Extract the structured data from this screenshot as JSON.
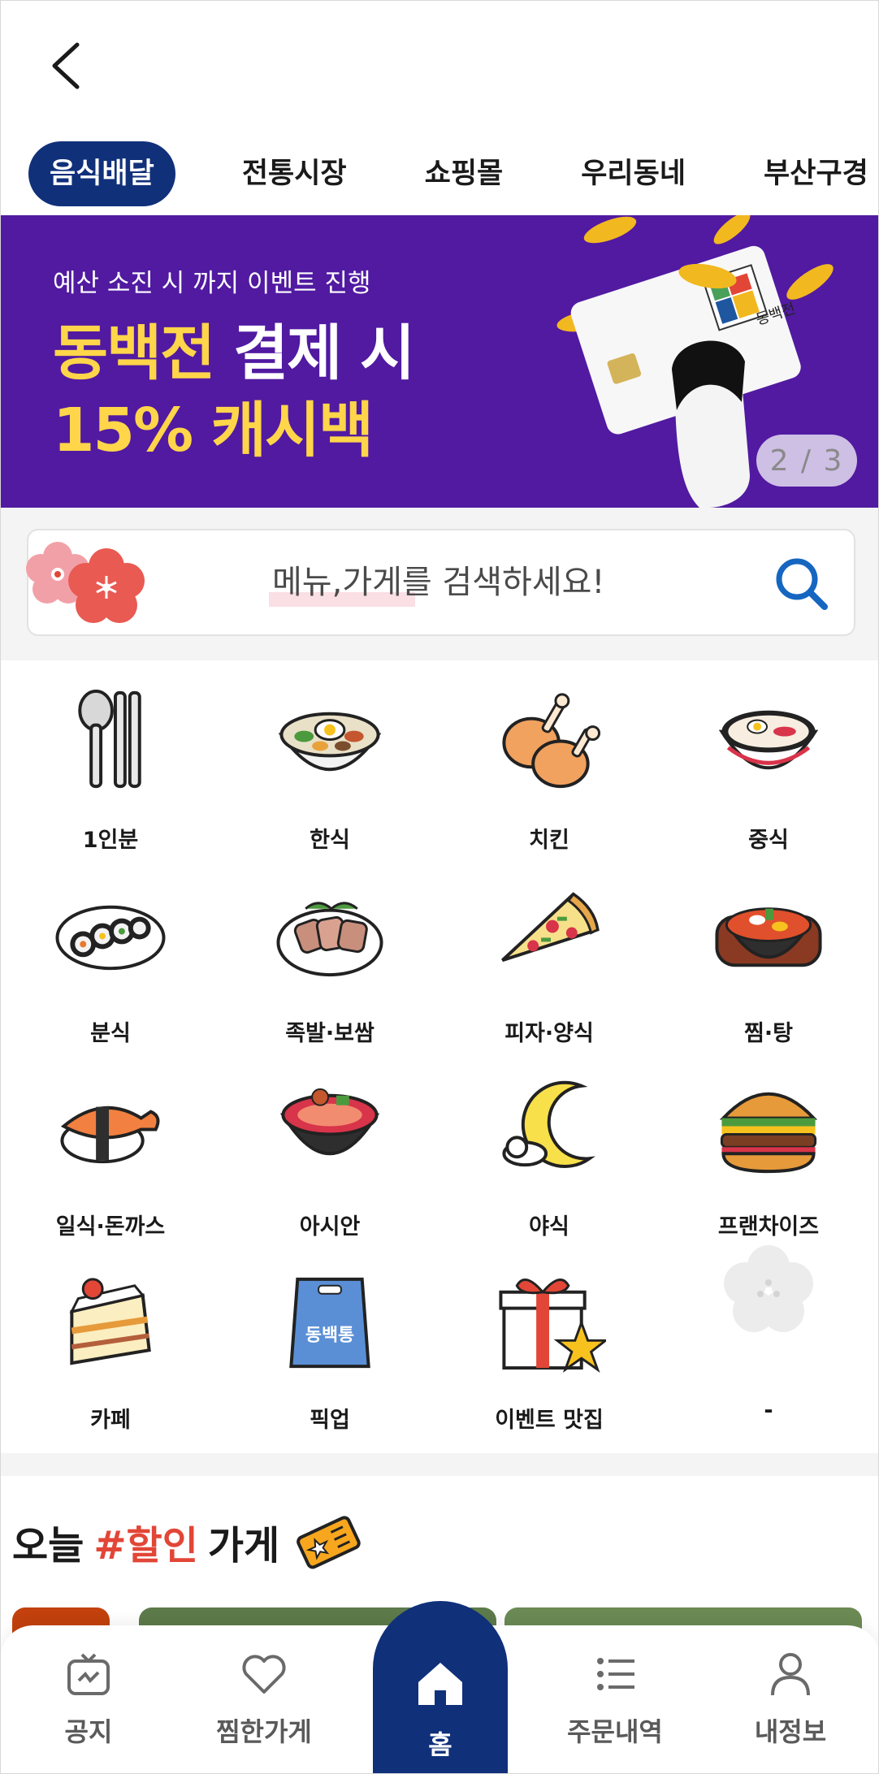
{
  "tabs": [
    {
      "label": "음식배달",
      "active": true
    },
    {
      "label": "전통시장"
    },
    {
      "label": "쇼핑몰"
    },
    {
      "label": "우리동네"
    },
    {
      "label": "부산구경"
    }
  ],
  "banner": {
    "subtitle": "예산 소진 시 까지 이벤트 진행",
    "line1_brand": "동백전",
    "line1_rest": "결제 시",
    "line2": "15% 캐시백",
    "card_text": "동백전",
    "pager": "2 / 3",
    "bg_color": "#511aa1",
    "accent_color": "#ffd54a"
  },
  "search": {
    "placeholder": "메뉴,가게를 검색하세요!"
  },
  "categories": [
    {
      "label": "1인분",
      "icon": "spoon-chopsticks-icon"
    },
    {
      "label": "한식",
      "icon": "bibimbap-icon"
    },
    {
      "label": "치킨",
      "icon": "chicken-icon"
    },
    {
      "label": "중식",
      "icon": "noodle-bowl-icon"
    },
    {
      "label": "분식",
      "icon": "gimbap-icon"
    },
    {
      "label": "족발·보쌈",
      "icon": "bossam-icon"
    },
    {
      "label": "피자·양식",
      "icon": "pizza-icon"
    },
    {
      "label": "찜·탕",
      "icon": "stew-pot-icon"
    },
    {
      "label": "일식·돈까스",
      "icon": "sushi-icon"
    },
    {
      "label": "아시안",
      "icon": "asian-bowl-icon"
    },
    {
      "label": "야식",
      "icon": "moon-icon"
    },
    {
      "label": "프랜차이즈",
      "icon": "burger-icon"
    },
    {
      "label": "카페",
      "icon": "cake-icon"
    },
    {
      "label": "픽업",
      "icon": "pickup-bag-icon"
    },
    {
      "label": "이벤트 맛집",
      "icon": "gift-icon"
    },
    {
      "label": "-",
      "icon": "camellia-placeholder-icon"
    }
  ],
  "pickup_bag_text": "동백통",
  "today": {
    "prefix": "오늘",
    "hashtag": "#할인",
    "suffix": "가게"
  },
  "nav": {
    "notice": "공지",
    "favorites": "찜한가게",
    "home": "홈",
    "orders": "주문내역",
    "profile": "내정보"
  },
  "colors": {
    "primary": "#10307a",
    "discount_red": "#e24637"
  }
}
